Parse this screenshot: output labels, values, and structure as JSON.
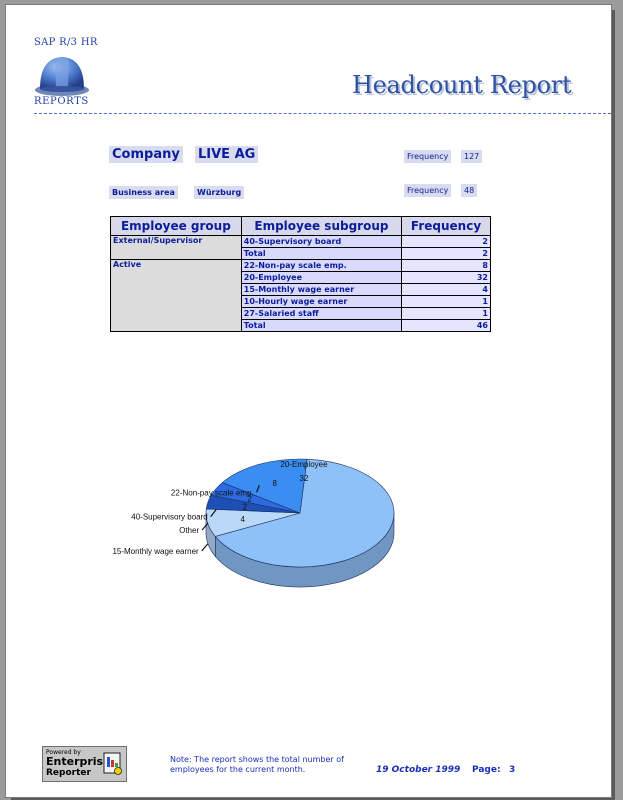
{
  "brand": {
    "top_text": "SAP R/3 HR",
    "bottom_text": "REPORTS"
  },
  "report_title": "Headcount Report",
  "company": {
    "label": "Company",
    "value": "LIVE AG",
    "frequency_label": "Frequency",
    "frequency_value": "127"
  },
  "business_area": {
    "label": "Business area",
    "value": "Würzburg",
    "frequency_label": "Frequency",
    "frequency_value": "48"
  },
  "table": {
    "headers": [
      "Employee group",
      "Employee subgroup",
      "Frequency"
    ],
    "groups": [
      {
        "group": "External/Supervisor",
        "rows": [
          {
            "subgroup": "40-Supervisory board",
            "frequency": "2"
          },
          {
            "subgroup": "Total",
            "frequency": "2"
          }
        ]
      },
      {
        "group": "Active",
        "rows": [
          {
            "subgroup": "22-Non-pay scale emp.",
            "frequency": "8"
          },
          {
            "subgroup": "20-Employee",
            "frequency": "32"
          },
          {
            "subgroup": "15-Monthly wage earner",
            "frequency": "4"
          },
          {
            "subgroup": "10-Hourly wage earner",
            "frequency": "1"
          },
          {
            "subgroup": "27-Salaried staff",
            "frequency": "1"
          },
          {
            "subgroup": "Total",
            "frequency": "46"
          }
        ]
      }
    ]
  },
  "chart_data": {
    "type": "pie",
    "slices": [
      {
        "label": "20-Employee",
        "value": 32,
        "color": "#8ec1f8"
      },
      {
        "label": "15-Monthly wage earner",
        "value": 4,
        "color": "#bad9f9"
      },
      {
        "label": "Other",
        "value": 2,
        "color": "#1e4fb4"
      },
      {
        "label": "40-Supervisory board",
        "value": 2,
        "color": "#2c6ae1"
      },
      {
        "label": "22-Non-pay scale emp.",
        "value": 8,
        "color": "#3a8ef2"
      }
    ]
  },
  "footer": {
    "logo_line1": "Powered by",
    "logo_line2": "Enterprise",
    "logo_line3": "Reporter",
    "note": "Note: The report shows the total number of employees for the current month.",
    "date": "19 October 1999",
    "page_label": "Page:",
    "page_value": "3"
  }
}
